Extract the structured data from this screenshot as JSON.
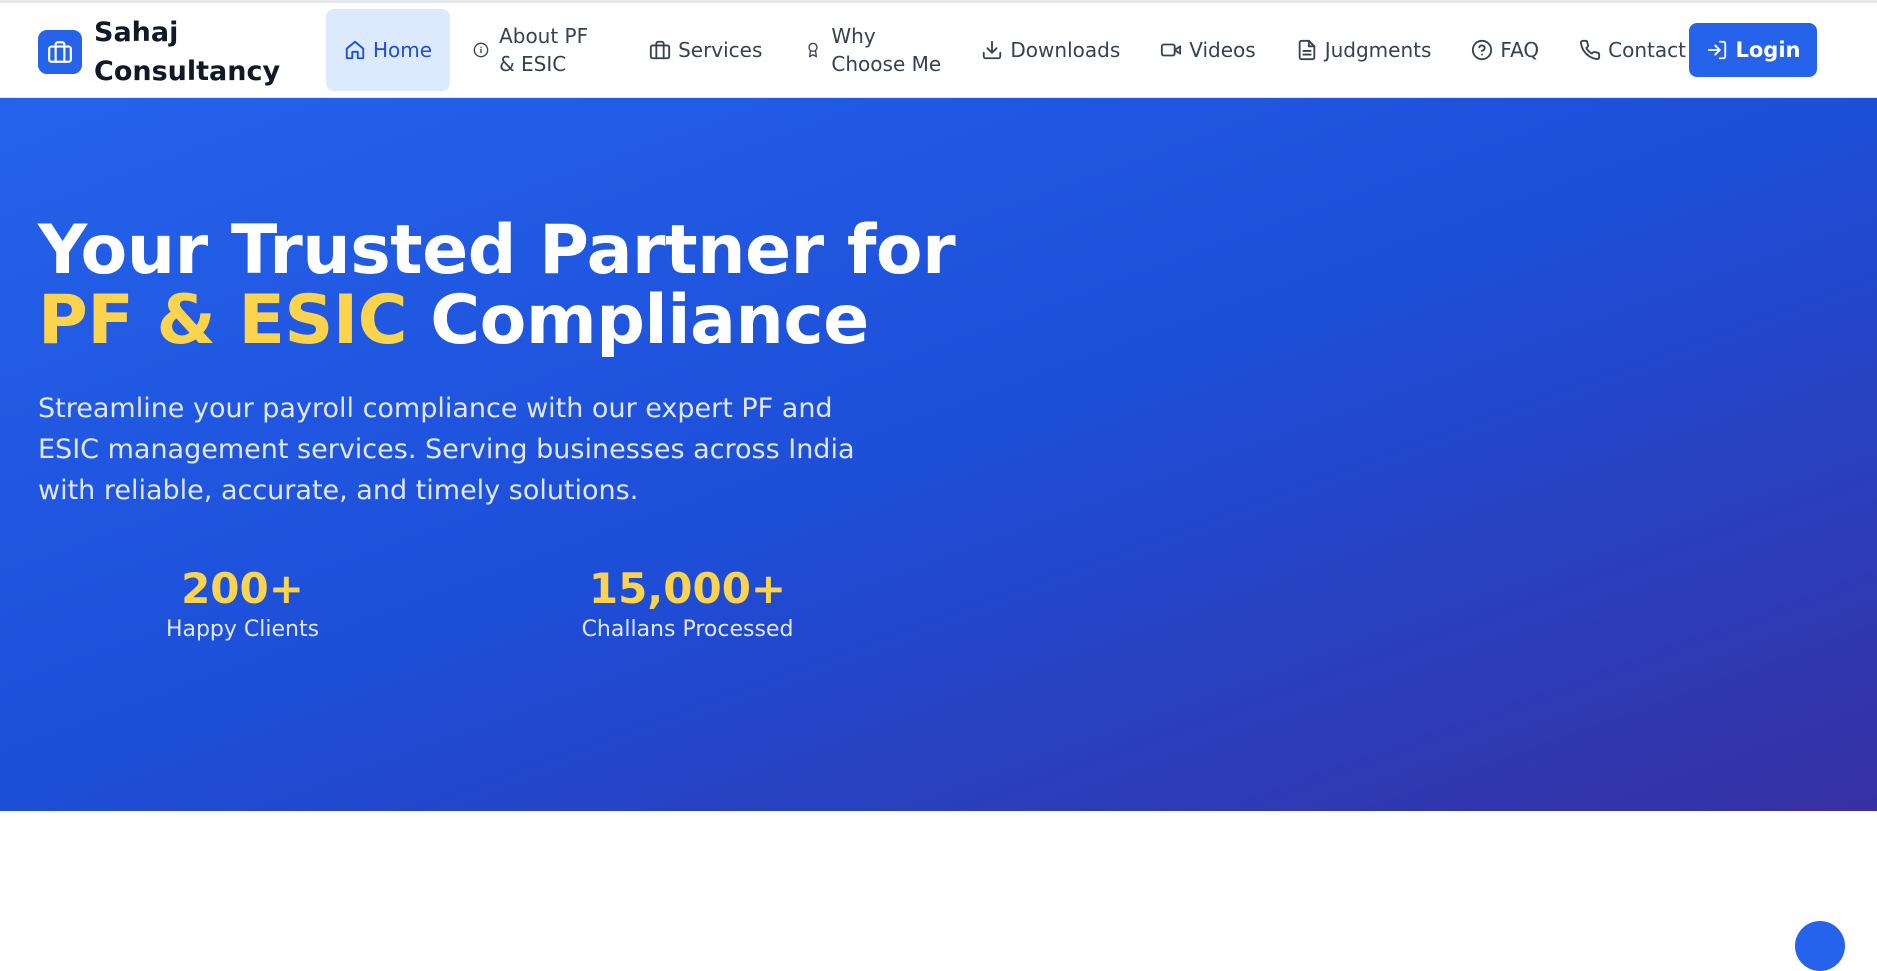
{
  "brand": {
    "name": "Sahaj Consultancy",
    "icon": "briefcase-icon"
  },
  "nav": {
    "items": [
      {
        "label": "Home",
        "icon": "home-icon",
        "active": true
      },
      {
        "label": "About PF & ESIC",
        "icon": "info-icon"
      },
      {
        "label": "Services",
        "icon": "briefcase-icon"
      },
      {
        "label": "Why Choose Me",
        "icon": "award-icon"
      },
      {
        "label": "Downloads",
        "icon": "download-icon"
      },
      {
        "label": "Videos",
        "icon": "video-icon"
      },
      {
        "label": "Judgments",
        "icon": "document-icon"
      },
      {
        "label": "FAQ",
        "icon": "help-circle-icon"
      },
      {
        "label": "Contact",
        "icon": "phone-icon"
      }
    ],
    "login_label": "Login",
    "login_icon": "login-icon"
  },
  "hero": {
    "title_line1": "Your Trusted Partner for",
    "title_accent": "PF & ESIC",
    "title_rest": " Compliance",
    "subtitle": "Streamline your payroll compliance with our expert PF and ESIC management services. Serving businesses across India with reliable, accurate, and timely solutions.",
    "stats": [
      {
        "value": "200+",
        "label": "Happy Clients"
      },
      {
        "value": "15,000+",
        "label": "Challans Processed"
      }
    ]
  },
  "colors": {
    "primary": "#2563eb",
    "accent": "#fcd34d",
    "active_bg": "#dbeafe",
    "hero_gradient_end": "#3730a3"
  }
}
